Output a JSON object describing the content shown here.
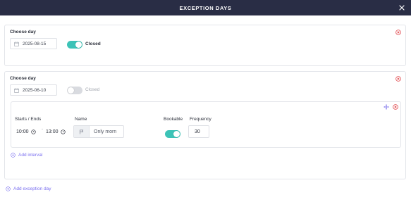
{
  "dialog": {
    "title": "EXCEPTION DAYS"
  },
  "days": [
    {
      "choose_label": "Choose day",
      "date": "2025-08-15",
      "closed_label": "Closed",
      "closed": true
    },
    {
      "choose_label": "Choose day",
      "date": "2025-06-10",
      "closed_label": "Closed",
      "closed": false,
      "interval": {
        "starts_ends_label": "Starts / Ends",
        "start": "10:00",
        "separator": "-",
        "end": "13:00",
        "name_label": "Name",
        "name_value": "Only morn",
        "bookable_label": "Bookable",
        "bookable": true,
        "frequency_label": "Frequency",
        "frequency": "30"
      },
      "add_interval_label": "Add interval"
    }
  ],
  "add_exception_day_label": "Add exception day",
  "colors": {
    "header_bg": "#292d45",
    "toggle_on": "#3cc3b7",
    "remove_red": "#e0454a",
    "link_purple": "#7a6ff0"
  }
}
